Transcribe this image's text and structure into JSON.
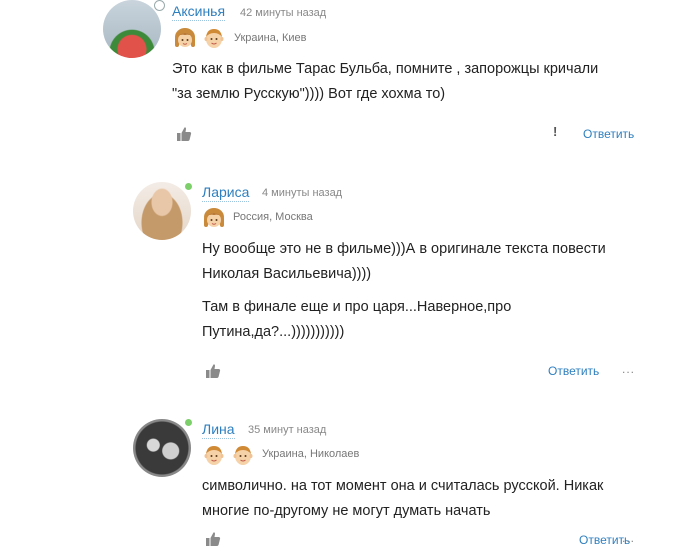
{
  "colors": {
    "link": "#2e7fbf",
    "online": "#7ccf6a",
    "away": "#b8b8b8",
    "meta": "#888888"
  },
  "comments": [
    {
      "author": "Аксинья",
      "time": "42 минуты назад",
      "location": "Украина, Киев",
      "status": "clock-icon",
      "badges": [
        "girl-badge-icon",
        "boy-badge-icon"
      ],
      "paragraphs": [
        "Это как в фильме Тарас Бульба, помните , запорожцы кричали \"за землю Русскую\")))) Вот где хохма то)"
      ],
      "reply_label": "Ответить",
      "report_label": "!"
    },
    {
      "author": "Лариса",
      "time": "4 минуты назад",
      "location": "Россия, Москва",
      "status": "online",
      "badges": [
        "girl-badge-icon"
      ],
      "paragraphs": [
        "Ну вообще это не в фильме)))А в оригинале текста повести Николая Васильевича))))",
        "Там в финале еще и про царя...Наверное,про Путина,да?...)))))))))))"
      ],
      "reply_label": "Ответить",
      "more_label": "..."
    },
    {
      "author": "Лина",
      "time": "35 минут назад",
      "location": "Украина, Николаев",
      "status": "online",
      "badges": [
        "boy-badge-icon",
        "boy-badge-icon"
      ],
      "paragraphs": [
        "символично. на тот момент она и считалась русской. Никак многие по-другому не могут думать начать"
      ],
      "reply_label": "Ответить",
      "more_label": "..."
    }
  ]
}
